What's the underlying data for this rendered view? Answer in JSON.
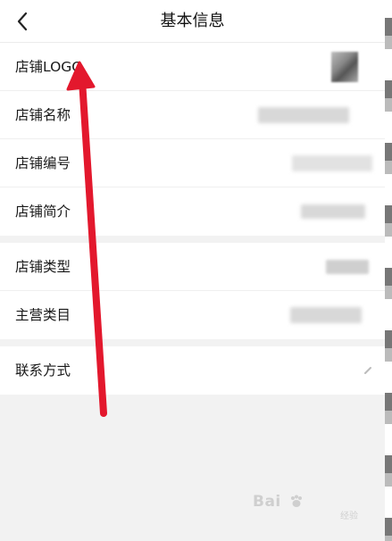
{
  "header": {
    "title": "基本信息"
  },
  "groups": [
    {
      "rows": [
        {
          "label": "店铺LOGO"
        },
        {
          "label": "店铺名称"
        },
        {
          "label": "店铺编号"
        },
        {
          "label": "店铺简介"
        }
      ]
    },
    {
      "rows": [
        {
          "label": "店铺类型"
        },
        {
          "label": "主营类目"
        }
      ]
    },
    {
      "rows": [
        {
          "label": "联系方式"
        }
      ]
    }
  ],
  "icons": {
    "back": "chevron-left-icon",
    "annotation": "red-arrow-annotation"
  },
  "colors": {
    "annotation": "#e3182d",
    "background": "#f2f2f2",
    "surface": "#ffffff"
  },
  "watermark": {
    "brand": "Bai",
    "suffix": "经验"
  }
}
